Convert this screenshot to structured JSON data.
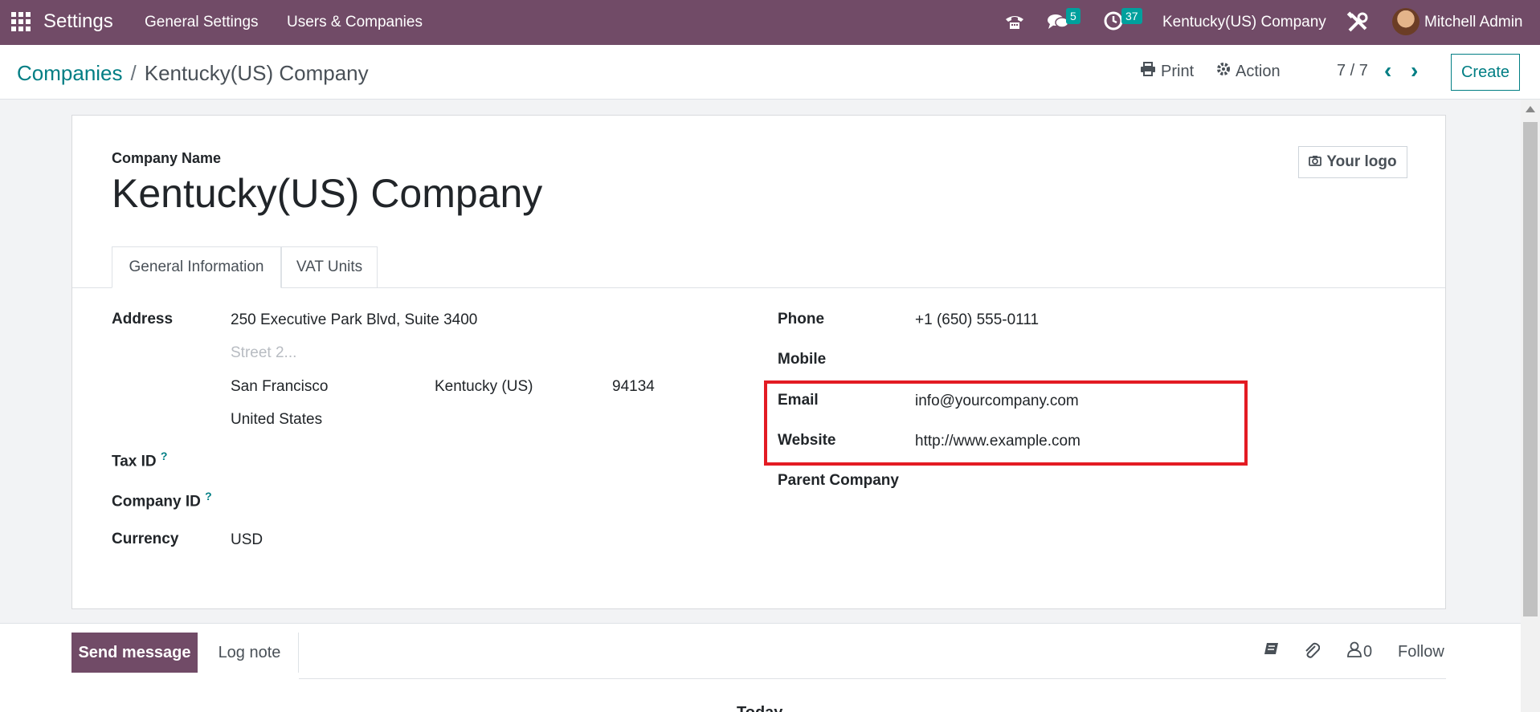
{
  "navbar": {
    "app_title": "Settings",
    "menu": [
      "General Settings",
      "Users & Companies"
    ],
    "messages_count": "5",
    "activities_count": "37",
    "company": "Kentucky(US) Company",
    "user": "Mitchell Admin",
    "color": "#714b67"
  },
  "control_panel": {
    "breadcrumb_parent": "Companies",
    "breadcrumb_separator": "/",
    "breadcrumb_current": "Kentucky(US) Company",
    "print_label": "Print",
    "action_label": "Action",
    "pager": "7 / 7",
    "create_label": "Create"
  },
  "form": {
    "company_name_label": "Company Name",
    "company_name": "Kentucky(US) Company",
    "logo_label": "Your logo",
    "tabs": [
      "General Information",
      "VAT Units"
    ],
    "address_label": "Address",
    "street": "250 Executive Park Blvd, Suite 3400",
    "street2_placeholder": "Street 2...",
    "city": "San Francisco",
    "state": "Kentucky (US)",
    "zip": "94134",
    "country": "United States",
    "tax_id_label": "Tax ID",
    "company_id_label": "Company ID",
    "help_mark": "?",
    "currency_label": "Currency",
    "currency": "USD",
    "phone_label": "Phone",
    "phone": "+1 (650) 555-0111",
    "mobile_label": "Mobile",
    "email_label": "Email",
    "email": "info@yourcompany.com",
    "website_label": "Website",
    "website": "http://www.example.com",
    "parent_company_label": "Parent Company"
  },
  "chatter": {
    "send_message": "Send message",
    "log_note": "Log note",
    "followers_count": "0",
    "follow": "Follow",
    "today": "Today"
  },
  "accent_color": "#017e84",
  "highlight_color": "#e31b23"
}
